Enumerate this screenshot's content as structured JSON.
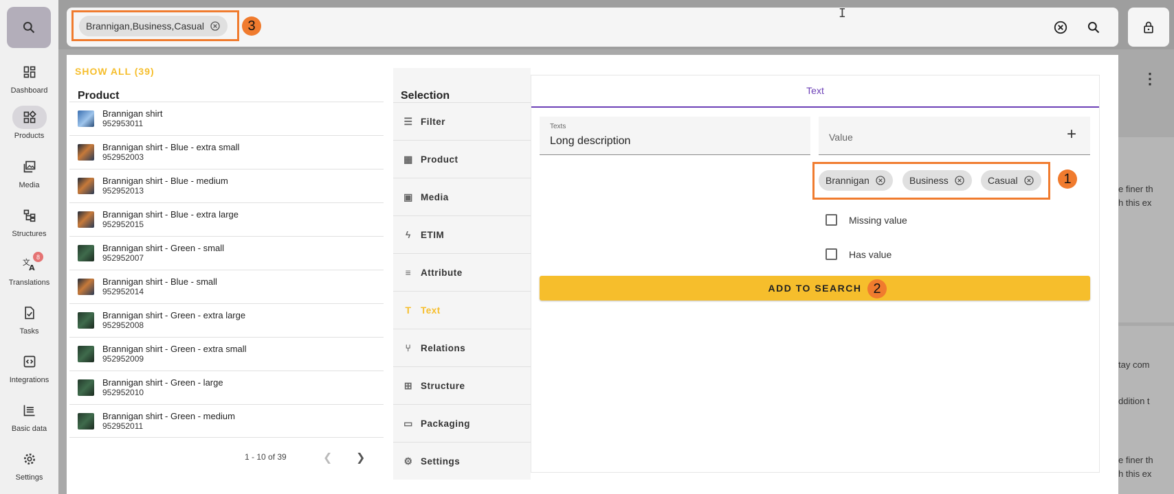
{
  "nav": {
    "items": [
      {
        "label": "Dashboard",
        "icon": "dashboard-icon"
      },
      {
        "label": "Products",
        "icon": "products-icon"
      },
      {
        "label": "Media",
        "icon": "media-icon"
      },
      {
        "label": "Structures",
        "icon": "structures-icon"
      },
      {
        "label": "Translations",
        "icon": "translations-icon",
        "badge": "8"
      },
      {
        "label": "Tasks",
        "icon": "tasks-icon"
      },
      {
        "label": "Integrations",
        "icon": "integrations-icon"
      },
      {
        "label": "Basic data",
        "icon": "basic-data-icon"
      },
      {
        "label": "Settings",
        "icon": "settings-icon"
      }
    ]
  },
  "search": {
    "chip": "Brannigan,Business,Casual",
    "marker": "3"
  },
  "results": {
    "show_all": "SHOW ALL (39)",
    "header": "Product",
    "products": [
      {
        "name": "Brannigan shirt",
        "sku": "952953011",
        "thumb": "blue"
      },
      {
        "name": "Brannigan shirt - Blue - extra small",
        "sku": "952952003",
        "thumb": "dark"
      },
      {
        "name": "Brannigan shirt - Blue - medium",
        "sku": "952952013",
        "thumb": "dark"
      },
      {
        "name": "Brannigan shirt - Blue - extra large",
        "sku": "952952015",
        "thumb": "dark"
      },
      {
        "name": "Brannigan shirt - Green - small",
        "sku": "952952007",
        "thumb": "green"
      },
      {
        "name": "Brannigan shirt - Blue - small",
        "sku": "952952014",
        "thumb": "dark"
      },
      {
        "name": "Brannigan shirt - Green - extra large",
        "sku": "952952008",
        "thumb": "green"
      },
      {
        "name": "Brannigan shirt - Green - extra small",
        "sku": "952952009",
        "thumb": "green"
      },
      {
        "name": "Brannigan shirt - Green - large",
        "sku": "952952010",
        "thumb": "green"
      },
      {
        "name": "Brannigan shirt - Green - medium",
        "sku": "952952011",
        "thumb": "green"
      }
    ],
    "pagination": "1 - 10 of 39"
  },
  "selection": {
    "header": "Selection",
    "items": [
      {
        "label": "Filter",
        "icon": "filter-icon"
      },
      {
        "label": "Product",
        "icon": "product-icon"
      },
      {
        "label": "Media",
        "icon": "media-icon"
      },
      {
        "label": "ETIM",
        "icon": "bolt-icon"
      },
      {
        "label": "Attribute",
        "icon": "attribute-icon"
      },
      {
        "label": "Text",
        "icon": "text-icon",
        "active": true
      },
      {
        "label": "Relations",
        "icon": "relations-icon"
      },
      {
        "label": "Structure",
        "icon": "structure-icon"
      },
      {
        "label": "Packaging",
        "icon": "packaging-icon"
      },
      {
        "label": "Settings",
        "icon": "settings-icon"
      }
    ]
  },
  "text_panel": {
    "tab": "Text",
    "texts_label": "Texts",
    "texts_value": "Long description",
    "value_placeholder": "Value",
    "chips": [
      "Brannigan",
      "Business",
      "Casual"
    ],
    "marker1": "1",
    "missing_value": "Missing value",
    "has_value": "Has value",
    "add_button": "ADD TO SEARCH",
    "marker2": "2"
  },
  "background": {
    "snippets": [
      "e finer th",
      "h this ex",
      "tay com",
      "ddition t",
      "e finer th",
      "h this ex"
    ]
  },
  "colors": {
    "accent_yellow": "#f6be2c",
    "tab_purple": "#6b3fb6",
    "highlight_orange": "#f07b2e"
  }
}
